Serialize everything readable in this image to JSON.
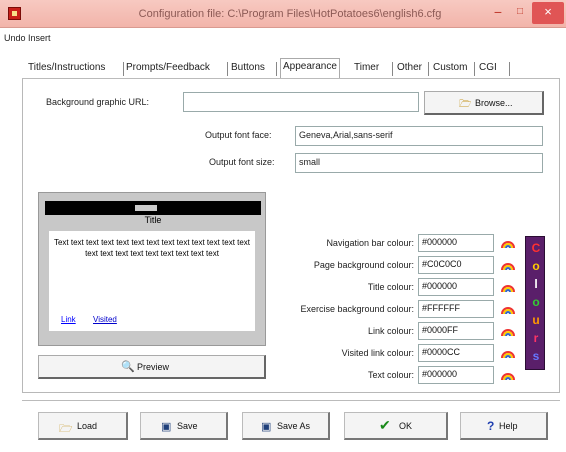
{
  "window": {
    "title": "Configuration file: C:\\Program Files\\HotPotatoes6\\english6.cfg",
    "minimize": "−",
    "maximize": "□",
    "close": "×"
  },
  "menu": {
    "items": [
      "Undo",
      "Insert"
    ]
  },
  "tabs": [
    {
      "label": "Titles/Instructions"
    },
    {
      "label": "Prompts/Feedback"
    },
    {
      "label": "Buttons"
    },
    {
      "label": "Appearance",
      "active": true
    },
    {
      "label": "Timer"
    },
    {
      "label": "Other"
    },
    {
      "label": "Custom"
    },
    {
      "label": "CGI"
    }
  ],
  "appearance": {
    "bg_graphic_label": "Background graphic URL:",
    "bg_graphic_value": "",
    "browse_label": "Browse...",
    "font_face_label": "Output font face:",
    "font_face_value": "Geneva,Arial,sans-serif",
    "font_size_label": "Output font size:",
    "font_size_value": "small"
  },
  "preview": {
    "title": "Title",
    "body_text": "Text text text text text text text text text text text text text text text text text text text text text text",
    "link_text": "Link",
    "visited_text": "Visited",
    "button_label": "Preview"
  },
  "colours": [
    {
      "label": "Navigation bar colour:",
      "value": "#000000"
    },
    {
      "label": "Page background colour:",
      "value": "#C0C0C0"
    },
    {
      "label": "Title colour:",
      "value": "#000000"
    },
    {
      "label": "Exercise background colour:",
      "value": "#FFFFFF"
    },
    {
      "label": "Link colour:",
      "value": "#0000FF"
    },
    {
      "label": "Visited link colour:",
      "value": "#0000CC"
    },
    {
      "label": "Text colour:",
      "value": "#000000"
    }
  ],
  "colours_banner": {
    "letters": [
      "C",
      "o",
      "l",
      "o",
      "u",
      "r",
      "s"
    ],
    "letter_colors": [
      "#ff3030",
      "#ffcc00",
      "#ffffff",
      "#33cc33",
      "#ff9900",
      "#ff3366",
      "#6677ff"
    ]
  },
  "footer": {
    "load_label": "Load",
    "save_label": "Save",
    "save_as_label": "Save As",
    "ok_label": "OK",
    "help_label": "Help"
  },
  "theme": {
    "accent": "#c8201a",
    "title_gradient": "#f2b4aa",
    "close_button": "#e05555"
  }
}
